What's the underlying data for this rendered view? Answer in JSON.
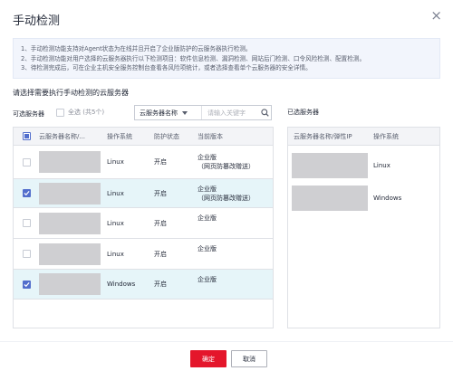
{
  "dialog": {
    "title": "手动检测",
    "close_glyph": "×"
  },
  "notice": {
    "lines": [
      "1、手动检测功能支持对Agent状态为在线并且开启了企业版防护的云服务器执行检测。",
      "2、手动检测功能对用户选择的云服务器执行以下检测项目：软件信息检测、漏洞检测、网站后门检测、口令风险检测、配置检测。",
      "3、待检测完成后，可在企业主机安全服务控制台查看各风险项统计，或者选择查看单个云服务器的安全详情。"
    ]
  },
  "section_label": "请选择需要执行手动检测的云服务器",
  "available": {
    "label": "可选服务器",
    "select_all": "全选 (共5个)",
    "filter_select": "云服务器名称",
    "search_placeholder": "请输入关键字",
    "columns": [
      "云服务器名称/...",
      "操作系统",
      "防护状态",
      "当前版本"
    ],
    "rows": [
      {
        "os": "Linux",
        "status": "开启",
        "version": "企业版",
        "version_note": "（网页防篡改赠送）",
        "checked": false
      },
      {
        "os": "Linux",
        "status": "开启",
        "version": "企业版",
        "version_note": "（网页防篡改赠送）",
        "checked": true
      },
      {
        "os": "Linux",
        "status": "开启",
        "version": "企业版",
        "version_note": "",
        "checked": false
      },
      {
        "os": "Linux",
        "status": "开启",
        "version": "企业版",
        "version_note": "",
        "checked": false
      },
      {
        "os": "Windows",
        "status": "开启",
        "version": "企业版",
        "version_note": "",
        "checked": true
      }
    ]
  },
  "selected": {
    "label": "已选服务器",
    "columns": [
      "云服务器名称/弹性IP",
      "操作系统"
    ],
    "rows": [
      {
        "os": "Linux"
      },
      {
        "os": "Windows"
      }
    ]
  },
  "footer": {
    "ok": "确定",
    "cancel": "取消"
  },
  "colors": {
    "primary": "#e4162b",
    "checkbox": "#526ecc",
    "selected_row": "#e6f5f9"
  }
}
